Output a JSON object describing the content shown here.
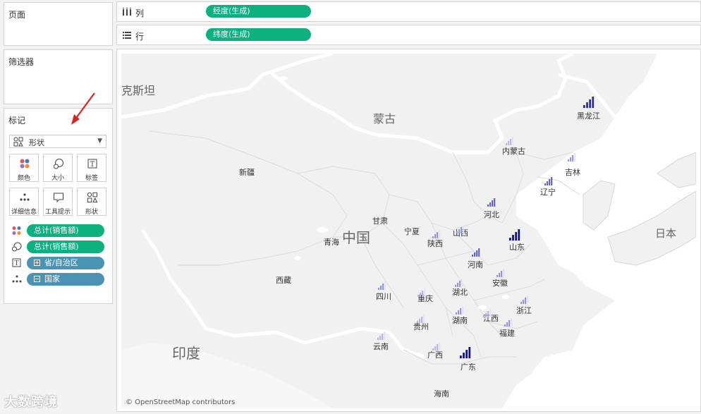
{
  "panels": {
    "pages_title": "页面",
    "filters_title": "筛选器",
    "marks_title": "标记",
    "mark_type": "形状",
    "mark_buttons": [
      "颜色",
      "大小",
      "标签",
      "详细信息",
      "工具提示",
      "形状"
    ],
    "mark_pills": [
      {
        "icon": "color-dots-icon",
        "label": "总计(销售额)",
        "color": "#0db07f"
      },
      {
        "icon": "size-icon",
        "label": "总计(销售额)",
        "color": "#0db07f"
      },
      {
        "icon": "label-text-icon",
        "label": "省/自治区",
        "color": "#4a93b5",
        "box": "plus"
      },
      {
        "icon": "detail-dots-icon",
        "label": "国家",
        "color": "#4a93b5",
        "box": "minus"
      }
    ]
  },
  "shelves": {
    "columns_label": "列",
    "columns_pill": "经度(生成)",
    "rows_label": "行",
    "rows_pill": "纬度(生成)"
  },
  "map": {
    "attribution": "© OpenStreetMap contributors",
    "countries": [
      {
        "name": "克斯坦",
        "style": "country"
      },
      {
        "name": "蒙古",
        "style": "country"
      },
      {
        "name": "中国",
        "style": "country-big"
      },
      {
        "name": "印度",
        "style": "country-big"
      },
      {
        "name": "日本",
        "style": "country"
      }
    ],
    "provinces": [
      {
        "name": "黑龙江",
        "signal": 4,
        "level": 4
      },
      {
        "name": "内蒙古",
        "signal": 3,
        "level": 1
      },
      {
        "name": "吉林",
        "signal": 3,
        "level": 2
      },
      {
        "name": "辽宁",
        "signal": 4,
        "level": 3
      },
      {
        "name": "新疆",
        "signal": 0,
        "level": 0
      },
      {
        "name": "河北",
        "signal": 4,
        "level": 3
      },
      {
        "name": "甘肃",
        "signal": 0,
        "level": 0
      },
      {
        "name": "宁夏",
        "signal": 0,
        "level": 0
      },
      {
        "name": "山西",
        "signal": 3,
        "level": 2
      },
      {
        "name": "青海",
        "signal": 0,
        "level": 0
      },
      {
        "name": "陕西",
        "signal": 3,
        "level": 2
      },
      {
        "name": "山东",
        "signal": 4,
        "level": 5
      },
      {
        "name": "河南",
        "signal": 4,
        "level": 3
      },
      {
        "name": "西藏",
        "signal": 0,
        "level": 0
      },
      {
        "name": "安徽",
        "signal": 3,
        "level": 2
      },
      {
        "name": "四川",
        "signal": 3,
        "level": 2
      },
      {
        "name": "湖北",
        "signal": 3,
        "level": 2
      },
      {
        "name": "重庆",
        "signal": 3,
        "level": 1
      },
      {
        "name": "浙江",
        "signal": 3,
        "level": 2
      },
      {
        "name": "江西",
        "signal": 3,
        "level": 1
      },
      {
        "name": "湖南",
        "signal": 3,
        "level": 2
      },
      {
        "name": "贵州",
        "signal": 3,
        "level": 1
      },
      {
        "name": "福建",
        "signal": 3,
        "level": 2
      },
      {
        "name": "云南",
        "signal": 3,
        "level": 1
      },
      {
        "name": "广西",
        "signal": 3,
        "level": 1
      },
      {
        "name": "广东",
        "signal": 4,
        "level": 5
      },
      {
        "name": "海南",
        "signal": 0,
        "level": 0
      }
    ],
    "level_colors": [
      "#c9c9ef",
      "#b3b3ea",
      "#8f8fdd",
      "#5a5ac8",
      "#2b2ba8",
      "#12127e"
    ]
  },
  "watermark": "大数跨境"
}
